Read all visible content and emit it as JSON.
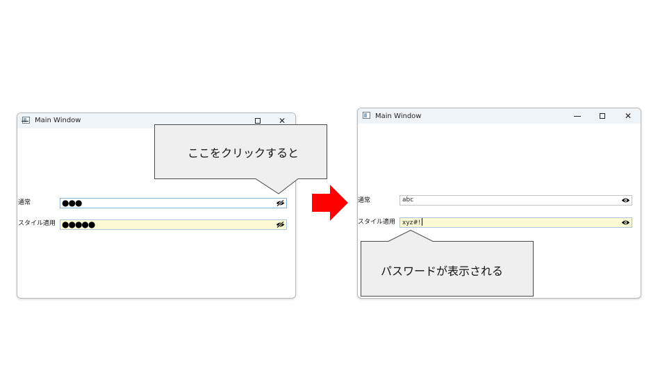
{
  "left_window": {
    "title": "Main Window",
    "controls": {
      "minimize": "─",
      "close": "✕"
    },
    "rows": [
      {
        "label": "通常",
        "masked_value": "●●●",
        "reveal_icon": "eye-slash-icon"
      },
      {
        "label": "スタイル適用",
        "masked_value": "●●●●●",
        "reveal_icon": "eye-slash-icon"
      }
    ]
  },
  "right_window": {
    "title": "Main Window",
    "controls": {
      "minimize": "─",
      "close": "✕"
    },
    "rows": [
      {
        "label": "通常",
        "value": "abc",
        "reveal_icon": "eye-icon"
      },
      {
        "label": "スタイル適用",
        "value": "xyz#!",
        "reveal_icon": "eye-icon"
      }
    ]
  },
  "callouts": {
    "click_here": "ここをクリックすると",
    "password_shown": "パスワードが表示される"
  },
  "colors": {
    "arrow": "#ff0000",
    "callout_fill": "#efefef",
    "styled_field_bg": "#fbfad5",
    "titlebar": "#eff4f9"
  }
}
